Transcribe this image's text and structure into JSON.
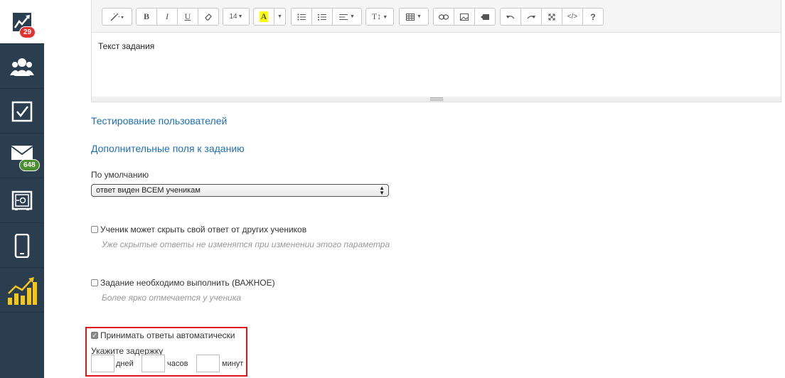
{
  "sidebar": {
    "items": [
      {
        "icon": "chart-trend-icon",
        "badge": "29"
      },
      {
        "icon": "users-group-icon"
      },
      {
        "icon": "checkbox-task-icon"
      },
      {
        "icon": "mail-icon",
        "badge": "648"
      },
      {
        "icon": "safe-icon"
      },
      {
        "icon": "mobile-phone-icon"
      },
      {
        "icon": "bar-chart-icon"
      }
    ]
  },
  "toolbar": {
    "font_size": "14",
    "buttons": [
      "magic-wand",
      "bold",
      "italic",
      "underline",
      "eraser",
      "font-size",
      "highlight-color",
      "color-dropdown",
      "unordered-list",
      "ordered-list",
      "paragraph-align",
      "line-height",
      "table",
      "link",
      "image",
      "video",
      "undo",
      "redo",
      "fullscreen",
      "code-view",
      "help"
    ],
    "labels": {
      "bold": "B",
      "italic": "I",
      "underline": "U",
      "help": "?",
      "code": "</>",
      "highlight": "A"
    }
  },
  "editor": {
    "content": "Текст задания"
  },
  "links": {
    "user_testing": "Тестирование пользователей",
    "extra_fields": "Дополнительные поля к заданию"
  },
  "default_section": {
    "label": "По умолчанию",
    "select_value": "ответ виден ВСЕМ ученикам"
  },
  "options": {
    "hide_answer": {
      "label": "Ученик может скрыть свой ответ от других учеников",
      "hint": "Уже скрытые ответы не изменятся при изменении этого параметра",
      "checked": false
    },
    "important": {
      "label": "Задание необходимо выполнить (ВАЖНОЕ)",
      "hint": "Более ярко отмечается у ученика",
      "checked": false
    },
    "auto_accept": {
      "label": "Принимать ответы автоматически",
      "checked": true
    }
  },
  "delay": {
    "label": "Укажите задержку",
    "days_label": "дней",
    "hours_label": "часов",
    "minutes_label": "минут",
    "days_value": "",
    "hours_value": "",
    "minutes_value": ""
  },
  "colors": {
    "sidebar": "#2b3e50",
    "link": "#1f6fb5",
    "highlight_border": "#e0141b",
    "badge_red": "#e0322f",
    "badge_green": "#4a8f2d",
    "highlight_yellow": "#ffff00"
  }
}
